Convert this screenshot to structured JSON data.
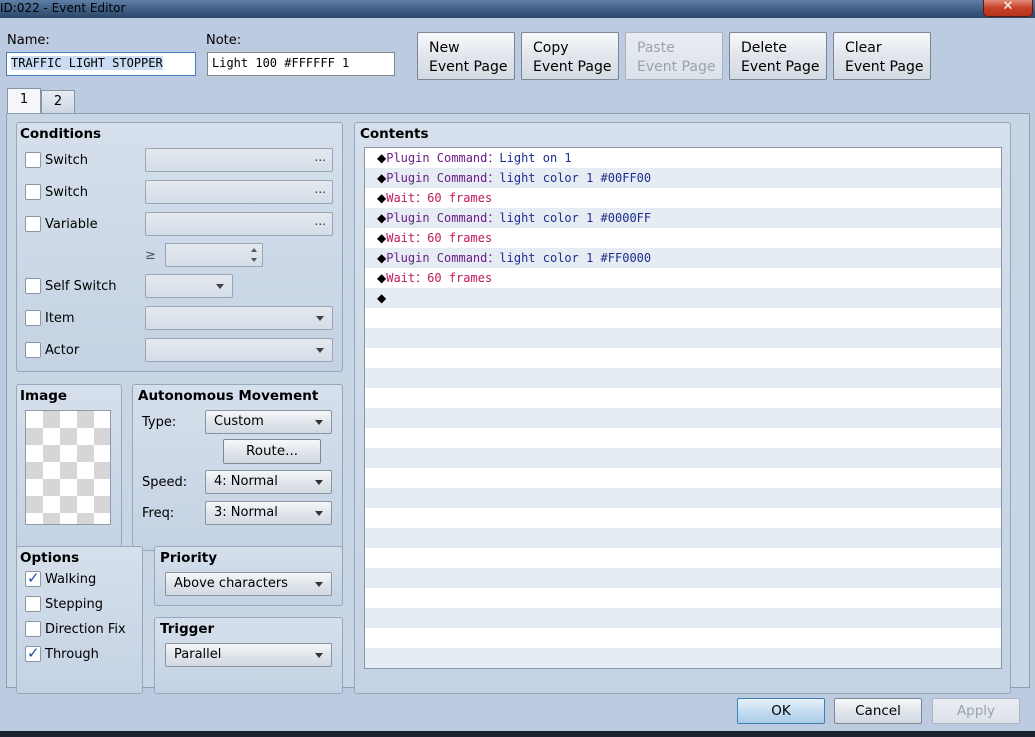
{
  "window": {
    "title": "ID:022 - Event Editor",
    "close_glyph": "✕"
  },
  "header": {
    "name_label": "Name:",
    "name_value": "TRAFFIC LIGHT STOPPER",
    "note_label": "Note:",
    "note_value": "Light 100 #FFFFFF 1"
  },
  "page_buttons": [
    {
      "line1": "New",
      "line2": "Event Page",
      "enabled": true
    },
    {
      "line1": "Copy",
      "line2": "Event Page",
      "enabled": true
    },
    {
      "line1": "Paste",
      "line2": "Event Page",
      "enabled": false
    },
    {
      "line1": "Delete",
      "line2": "Event Page",
      "enabled": true
    },
    {
      "line1": "Clear",
      "line2": "Event Page",
      "enabled": true
    }
  ],
  "tabs": [
    {
      "label": "1",
      "active": true
    },
    {
      "label": "2",
      "active": false
    }
  ],
  "conditions": {
    "title": "Conditions",
    "switch1": "Switch",
    "switch2": "Switch",
    "variable": "Variable",
    "gte": "≥",
    "self_switch": "Self Switch",
    "item": "Item",
    "actor": "Actor",
    "ellipsis": "..."
  },
  "image": {
    "title": "Image"
  },
  "autonomous": {
    "title": "Autonomous Movement",
    "type_label": "Type:",
    "type_value": "Custom",
    "route_button": "Route...",
    "speed_label": "Speed:",
    "speed_value": "4: Normal",
    "freq_label": "Freq:",
    "freq_value": "3: Normal"
  },
  "options": {
    "title": "Options",
    "walking": "Walking",
    "walking_checked": true,
    "stepping": "Stepping",
    "stepping_checked": false,
    "direction_fix": "Direction Fix",
    "direction_fix_checked": false,
    "through": "Through",
    "through_checked": true
  },
  "priority": {
    "title": "Priority",
    "value": "Above characters"
  },
  "trigger": {
    "title": "Trigger",
    "value": "Parallel"
  },
  "contents": {
    "title": "Contents",
    "rows": [
      {
        "cmd": "Plugin Command",
        "arg": "Light on 1",
        "kind": "plugin"
      },
      {
        "cmd": "Plugin Command",
        "arg": "light color 1 #00FF00",
        "kind": "plugin"
      },
      {
        "cmd": "Wait",
        "arg": "60 frames",
        "kind": "wait"
      },
      {
        "cmd": "Plugin Command",
        "arg": "light color 1 #0000FF",
        "kind": "plugin"
      },
      {
        "cmd": "Wait",
        "arg": "60 frames",
        "kind": "wait"
      },
      {
        "cmd": "Plugin Command",
        "arg": "light color 1 #FF0000",
        "kind": "plugin"
      },
      {
        "cmd": "Wait",
        "arg": "60 frames",
        "kind": "wait"
      },
      {
        "cmd": "",
        "arg": "",
        "kind": "empty"
      }
    ],
    "blank_rows": 18
  },
  "footer": {
    "ok": "OK",
    "cancel": "Cancel",
    "apply": "Apply"
  },
  "colors": {
    "plugin_cmd": "#6b1d87",
    "plugin_arg": "#1e2d8f",
    "wait": "#c2185b",
    "accent": "#3c7fb1"
  },
  "glyphs": {
    "diamond": "◆",
    "separator": "："
  }
}
